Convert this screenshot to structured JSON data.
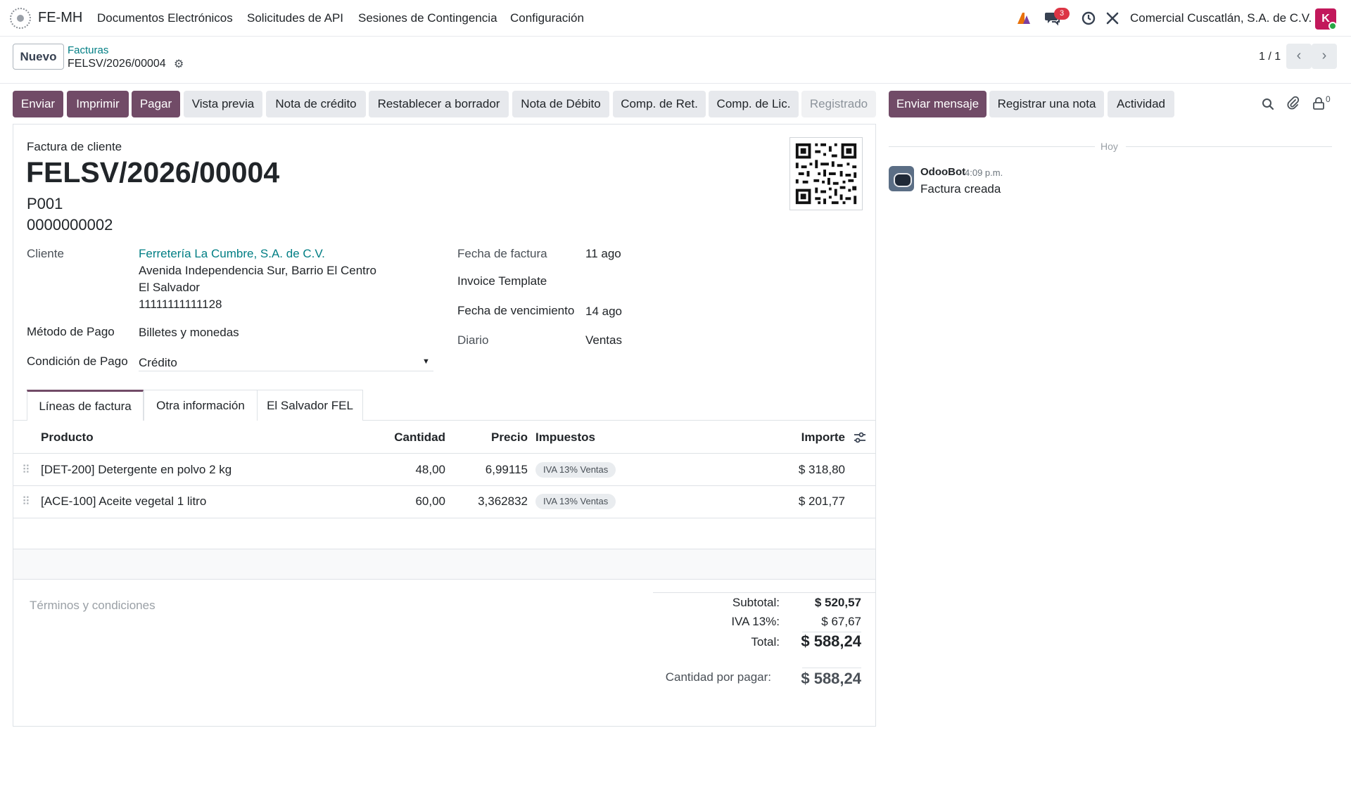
{
  "navbar": {
    "app_name": "FE-MH",
    "menu": [
      "Documentos Electrónicos",
      "Solicitudes de API",
      "Sesiones de Contingencia",
      "Configuración"
    ],
    "chat_count": "3",
    "company": "Comercial Cuscatlán, S.A. de C.V.",
    "avatar_initial": "K"
  },
  "control_panel": {
    "new_button": "Nuevo",
    "breadcrumb_parent": "Facturas",
    "breadcrumb_current": "FELSV/2026/00004",
    "pager": "1 / 1"
  },
  "actions": {
    "buttons": [
      "Enviar",
      "Imprimir",
      "Pagar",
      "Vista previa",
      "Nota de crédito",
      "Restablecer a borrador",
      "Nota de Débito",
      "Comp. de Ret.",
      "Comp. de Lic."
    ],
    "status": "Registrado"
  },
  "chatter_actions": {
    "send_message": "Enviar mensaje",
    "log_note": "Registrar una nota",
    "activity": "Actividad",
    "followers_count": "0"
  },
  "invoice": {
    "type_label": "Factura de cliente",
    "number": "FELSV/2026/00004",
    "code_1": "P001",
    "code_2": "0000000002",
    "customer_label": "Cliente",
    "customer_name": "Ferretería La Cumbre, S.A. de C.V.",
    "customer_address_1": "Avenida Independencia Sur, Barrio El Centro",
    "customer_address_2": "El Salvador",
    "customer_id": "11111111111128",
    "payment_method_label": "Método de Pago",
    "payment_method": "Billetes y monedas",
    "payment_condition_label": "Condición de Pago",
    "payment_condition": "Crédito",
    "invoice_date_label": "Fecha de factura",
    "invoice_date": "11 ago",
    "template_label": "Invoice Template",
    "due_date_label": "Fecha de vencimiento",
    "due_date": "14 ago",
    "journal_label": "Diario",
    "journal": "Ventas"
  },
  "tabs": [
    "Líneas de factura",
    "Otra información",
    "El Salvador FEL"
  ],
  "lines": {
    "headers": {
      "product": "Producto",
      "quantity": "Cantidad",
      "price": "Precio",
      "taxes": "Impuestos",
      "amount": "Importe"
    },
    "rows": [
      {
        "product": "[DET-200] Detergente en polvo 2 kg",
        "quantity": "48,00",
        "price": "6,99115",
        "tax": "IVA 13% Ventas",
        "amount": "$ 318,80"
      },
      {
        "product": "[ACE-100] Aceite vegetal 1 litro",
        "quantity": "60,00",
        "price": "3,362832",
        "tax": "IVA 13% Ventas",
        "amount": "$ 201,77"
      }
    ]
  },
  "terms_placeholder": "Términos y condiciones",
  "totals": {
    "subtotal_label": "Subtotal:",
    "subtotal": "$ 520,57",
    "iva_label": "IVA 13%:",
    "iva": "$ 67,67",
    "total_label": "Total:",
    "total": "$ 588,24",
    "due_label": "Cantidad por pagar:",
    "due": "$ 588,24"
  },
  "chatter": {
    "date_separator": "Hoy",
    "author": "OdooBot",
    "time": "4:09 p.m.",
    "message": "Factura creada"
  },
  "colors": {
    "brand": "#714b67",
    "link": "#017e84",
    "badge": "#dc3545"
  }
}
